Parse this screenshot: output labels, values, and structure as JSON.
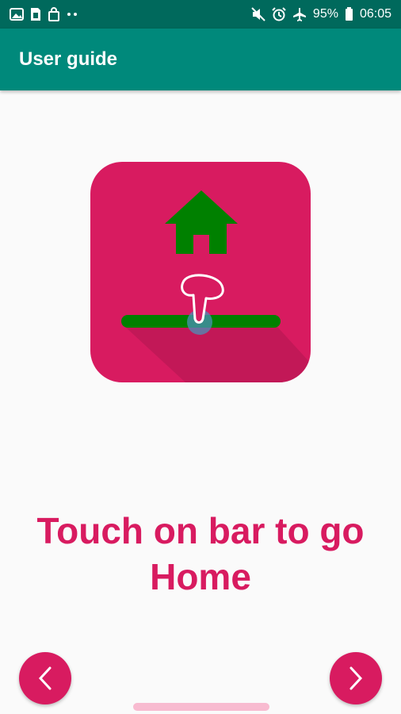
{
  "status_bar": {
    "left_icons": [
      "image-icon",
      "sim-icon",
      "bag-icon",
      "dots-icon"
    ],
    "right_icons": [
      "mute-icon",
      "alarm-icon",
      "airplane-icon",
      "battery-icon"
    ],
    "battery": "95%",
    "time": "06:05"
  },
  "app_bar": {
    "title": "User guide"
  },
  "illustration": {
    "icon": "touch-bar-home-icon",
    "background_color": "#d81b60",
    "home_color": "#008000",
    "bar_color": "#008000"
  },
  "message": {
    "text": "Touch on bar to go Home"
  },
  "nav": {
    "prev_icon": "chevron-left-icon",
    "next_icon": "chevron-right-icon",
    "button_color": "#d81b60"
  },
  "colors": {
    "status_bar": "#00695c",
    "app_bar": "#00897b",
    "accent": "#d81b60"
  }
}
